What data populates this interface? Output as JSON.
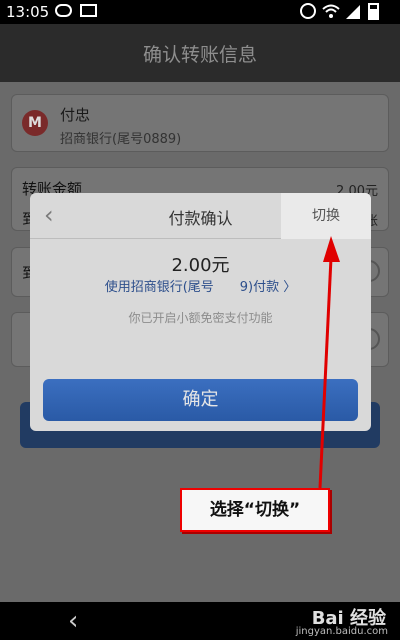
{
  "status_bar": {
    "time": "13:05",
    "icons": [
      "message-icon",
      "image-icon",
      "alarm-icon",
      "wifi-icon",
      "signal-icon",
      "battery-icon"
    ]
  },
  "title_bar": {
    "title": "确认转账信息"
  },
  "payee": {
    "name": "付忠",
    "bank": "招商银行(尾号0889)",
    "logo_icon": "cmb-logo-icon"
  },
  "amount_section": {
    "amount_label": "转账金额",
    "amount_value": "2.00元",
    "row2_label": "到",
    "row2_value": "账"
  },
  "row3": {
    "label": "到"
  },
  "dialog": {
    "title": "付款确认",
    "switch_label": "切换",
    "amount": "2.00元",
    "method": "使用招商银行(尾号　　9)付款 〉",
    "hint": "你已开启小额免密支付功能",
    "confirm_label": "确定"
  },
  "callout": {
    "text": "选择“切换”"
  },
  "watermark": {
    "brand": "Bai 经验",
    "url": "jingyan.baidu.com"
  },
  "colors": {
    "accent": "#2a5aa6",
    "callout_border": "#e00000",
    "arrow": "#e00000"
  }
}
